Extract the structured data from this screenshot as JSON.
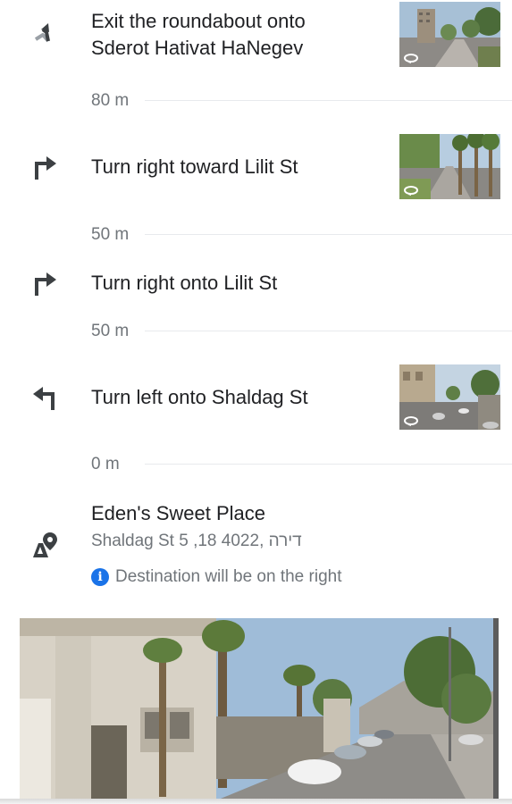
{
  "steps": [
    {
      "instruction": "Exit the roundabout onto Sderot Hativat HaNegev",
      "line1": "Exit the roundabout onto",
      "line2": "Sderot Hativat HaNegev",
      "icon": "roundabout-exit-icon",
      "has_thumbnail": true
    },
    {
      "distance": "80 m"
    },
    {
      "instruction": "Turn right toward Lilit St",
      "icon": "turn-right-icon",
      "has_thumbnail": true
    },
    {
      "distance": "50 m"
    },
    {
      "instruction": "Turn right onto Lilit St",
      "icon": "turn-right-icon",
      "has_thumbnail": false
    },
    {
      "distance": "50 m"
    },
    {
      "instruction": "Turn left onto Shaldag St",
      "icon": "turn-left-icon",
      "has_thumbnail": true
    },
    {
      "distance": "0 m"
    }
  ],
  "destination": {
    "name": "Eden's Sweet Place",
    "address": "Shaldag St 5 ,18 דירה ,4022",
    "icon": "destination-pin-icon",
    "note": "Destination will be on the right",
    "note_icon": "info-icon"
  },
  "colors": {
    "text_primary": "#202124",
    "text_secondary": "#70757a",
    "accent": "#1a73e8",
    "icon": "#3c4043"
  }
}
